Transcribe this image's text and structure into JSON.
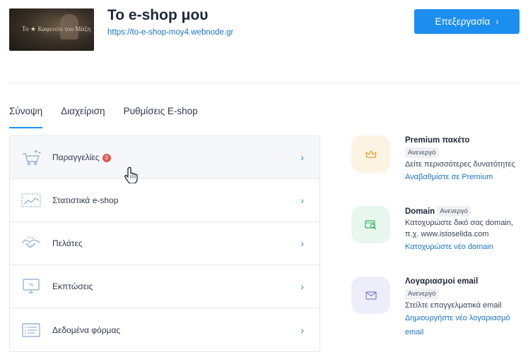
{
  "site": {
    "title": "Το e-shop μου",
    "url": "https://to-e-shop-moy4.webnode.gr",
    "thumbnail_text": "Το ★ Καφενείο του Μάξη"
  },
  "header": {
    "edit_label": "Επεξεργασία",
    "edit_chevron": "›"
  },
  "tabs": [
    {
      "label": "Σύνοψη",
      "active": true
    },
    {
      "label": "Διαχείριση",
      "active": false
    },
    {
      "label": "Ρυθμίσεις E-shop",
      "active": false
    }
  ],
  "menu": {
    "items": [
      {
        "label": "Παραγγελίες",
        "icon": "cart-icon",
        "badge": "3"
      },
      {
        "label": "Στατιστικά e-shop",
        "icon": "stats-chart-icon"
      },
      {
        "label": "Πελάτες",
        "icon": "handshake-icon"
      },
      {
        "label": "Εκπτώσεις",
        "icon": "discount-monitor-icon"
      },
      {
        "label": "Δεδομένα φόρμας",
        "icon": "form-data-icon"
      }
    ],
    "chevron": "›"
  },
  "cards": [
    {
      "title": "Premium πακέτο",
      "status": "Ανενεργό",
      "description": "Δείτε περισσότερες δυνατότητες",
      "link": "Αναβαθμίστε σε Premium",
      "icon": "crown-icon",
      "color": "#fdf3e3"
    },
    {
      "title": "Domain",
      "status": "Ανενεργό",
      "description": "Κατοχυρώστε δικό σας domain, π.χ. www.istoselida.com",
      "link": "Κατοχυρώστε νέο domain",
      "icon": "domain-search-icon",
      "color": "#e8f7ee"
    },
    {
      "title": "Λογαριασμοί email",
      "status": "Ανενεργό",
      "description": "Στείλτε επαγγελματικά email",
      "link": "Δημιουργήστε νέο λογαριασμό email",
      "icon": "envelope-icon",
      "color": "#eeeefb"
    }
  ],
  "colors": {
    "accent": "#1b8ef0",
    "link": "#1a74c7",
    "badge": "#e25550"
  }
}
